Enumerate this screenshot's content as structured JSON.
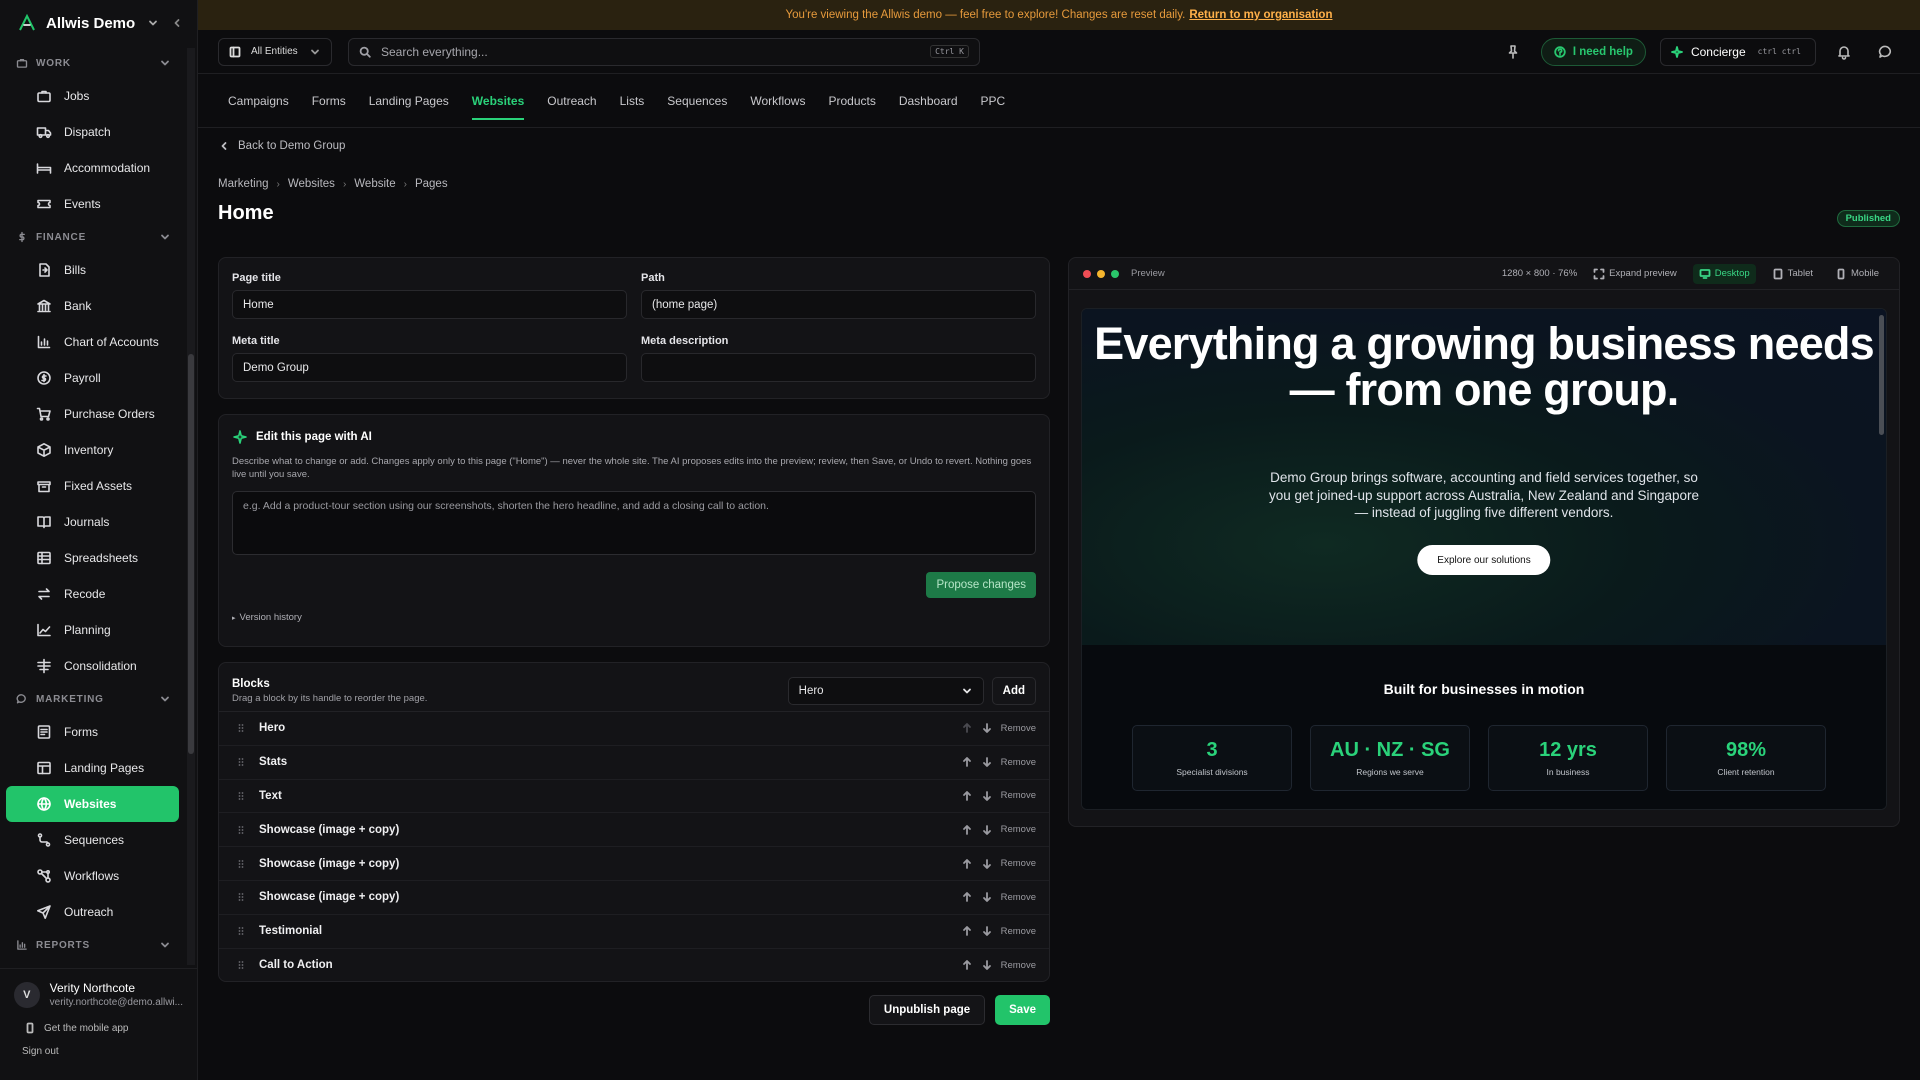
{
  "banner": {
    "text": "You're viewing the Allwis demo — feel free to explore! Changes are reset daily.",
    "link": "Return to my organisation"
  },
  "sidebar": {
    "org": "Allwis Demo",
    "sections": [
      {
        "label": "WORK",
        "icon": "briefcase-icon",
        "items": [
          {
            "label": "Jobs",
            "icon": "briefcase-icon"
          },
          {
            "label": "Dispatch",
            "icon": "truck-icon"
          },
          {
            "label": "Accommodation",
            "icon": "bed-icon"
          },
          {
            "label": "Events",
            "icon": "ticket-icon"
          }
        ]
      },
      {
        "label": "FINANCE",
        "icon": "dollar-icon",
        "items": [
          {
            "label": "Bills",
            "icon": "file-in-icon"
          },
          {
            "label": "Bank",
            "icon": "bank-icon"
          },
          {
            "label": "Chart of Accounts",
            "icon": "bar-chart-icon"
          },
          {
            "label": "Payroll",
            "icon": "dollar-circle-icon"
          },
          {
            "label": "Purchase Orders",
            "icon": "cart-icon"
          },
          {
            "label": "Inventory",
            "icon": "box-icon"
          },
          {
            "label": "Fixed Assets",
            "icon": "archive-icon"
          },
          {
            "label": "Journals",
            "icon": "book-icon"
          },
          {
            "label": "Spreadsheets",
            "icon": "table-icon"
          },
          {
            "label": "Recode",
            "icon": "swap-icon"
          },
          {
            "label": "Planning",
            "icon": "trend-icon"
          },
          {
            "label": "Consolidation",
            "icon": "sliders-icon"
          }
        ]
      },
      {
        "label": "MARKETING",
        "icon": "chat-icon",
        "items": [
          {
            "label": "Forms",
            "icon": "form-icon"
          },
          {
            "label": "Landing Pages",
            "icon": "layout-icon"
          },
          {
            "label": "Websites",
            "icon": "globe-icon",
            "active": true
          },
          {
            "label": "Sequences",
            "icon": "route-icon"
          },
          {
            "label": "Workflows",
            "icon": "workflow-icon"
          },
          {
            "label": "Outreach",
            "icon": "send-icon"
          }
        ]
      },
      {
        "label": "REPORTS",
        "icon": "bar-chart-icon",
        "items": []
      }
    ],
    "user": {
      "initial": "V",
      "name": "Verity Northcote",
      "email": "verity.northcote@demo.allwi..."
    },
    "mobile_app": "Get the mobile app",
    "sign_out": "Sign out"
  },
  "topbar": {
    "entity": "All Entities",
    "search_placeholder": "Search everything...",
    "search_kbd": "Ctrl K",
    "help": "I need help",
    "concierge": "Concierge",
    "concierge_kbd": "ctrl ctrl"
  },
  "tabs": [
    "Campaigns",
    "Forms",
    "Landing Pages",
    "Websites",
    "Outreach",
    "Lists",
    "Sequences",
    "Workflows",
    "Products",
    "Dashboard",
    "PPC"
  ],
  "active_tab": "Websites",
  "page": {
    "back": "Back to Demo Group",
    "breadcrumb": [
      "Marketing",
      "Websites",
      "Website",
      "Pages"
    ],
    "title": "Home",
    "status": "Published"
  },
  "fields": {
    "page_title_label": "Page title",
    "page_title_value": "Home",
    "path_label": "Path",
    "path_value": "(home page)",
    "meta_title_label": "Meta title",
    "meta_title_value": "Demo Group",
    "meta_desc_label": "Meta description",
    "meta_desc_value": ""
  },
  "ai": {
    "title": "Edit this page with AI",
    "desc": "Describe what to change or add. Changes apply only to this page (\"Home\") — never the whole site. The AI proposes edits into the preview; review, then Save, or Undo to revert. Nothing goes live until you save.",
    "placeholder": "e.g. Add a product-tour section using our screenshots, shorten the hero headline, and add a closing call to action.",
    "propose": "Propose changes",
    "version_history": "Version history"
  },
  "blocks": {
    "title": "Blocks",
    "subtitle": "Drag a block by its handle to reorder the page.",
    "select_value": "Hero",
    "add": "Add",
    "remove": "Remove",
    "items": [
      "Hero",
      "Stats",
      "Text",
      "Showcase (image + copy)",
      "Showcase (image + copy)",
      "Showcase (image + copy)",
      "Testimonial",
      "Call to Action"
    ]
  },
  "actions": {
    "unpublish": "Unpublish page",
    "save": "Save"
  },
  "preview": {
    "label": "Preview",
    "size": "1280 × 800 · 76%",
    "expand": "Expand preview",
    "desktop": "Desktop",
    "tablet": "Tablet",
    "mobile": "Mobile",
    "hero_title": "Everything a growing business needs — from one group.",
    "hero_text": "Demo Group brings software, accounting and field services together, so you get joined-up support across Australia, New Zealand and Singapore — instead of juggling five different vendors.",
    "hero_cta": "Explore our solutions",
    "stats_title": "Built for businesses in motion",
    "stats": [
      {
        "value": "3",
        "label": "Specialist divisions"
      },
      {
        "value": "AU · NZ · SG",
        "label": "Regions we serve"
      },
      {
        "value": "12 yrs",
        "label": "In business"
      },
      {
        "value": "98%",
        "label": "Client retention"
      }
    ]
  },
  "colors": {
    "accent": "#22c46a",
    "banner_text": "#e69a3c",
    "background": "#0c0c0e"
  }
}
